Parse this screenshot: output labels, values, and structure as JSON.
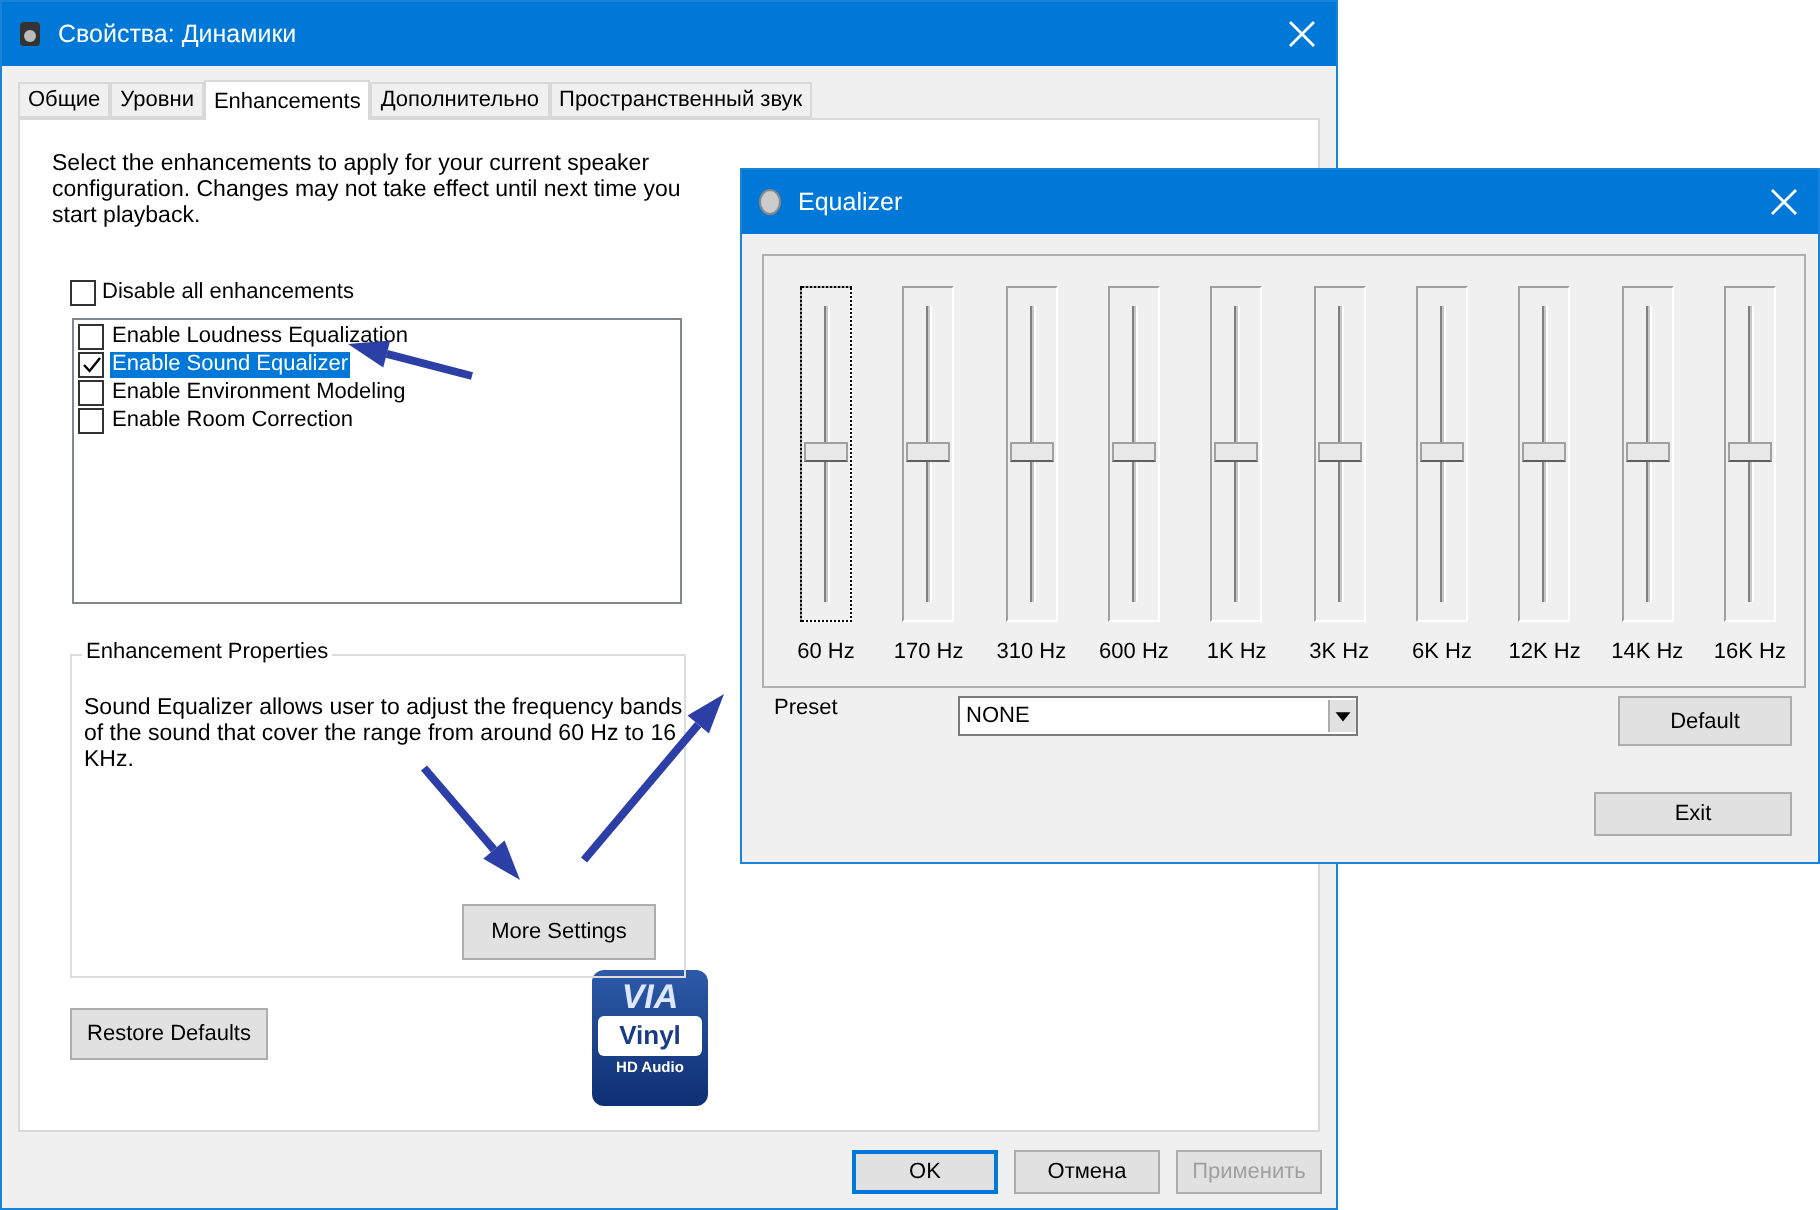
{
  "main_window": {
    "title": "Свойства: Динамики",
    "tabs": [
      {
        "label": "Общие",
        "selected": false
      },
      {
        "label": "Уровни",
        "selected": false
      },
      {
        "label": "Enhancements",
        "selected": true
      },
      {
        "label": "Дополнительно",
        "selected": false
      },
      {
        "label": "Пространственный звук",
        "selected": false
      }
    ],
    "intro": "Select the enhancements to apply for your current speaker configuration. Changes may not take effect until next time you start playback.",
    "disable_all": {
      "label": "Disable all enhancements",
      "checked": false
    },
    "enhancements": [
      {
        "label": "Enable Loudness Equalization",
        "checked": false,
        "selected": false
      },
      {
        "label": "Enable Sound Equalizer",
        "checked": true,
        "selected": true
      },
      {
        "label": "Enable Environment Modeling",
        "checked": false,
        "selected": false
      },
      {
        "label": "Enable Room Correction",
        "checked": false,
        "selected": false
      }
    ],
    "properties": {
      "title": "Enhancement Properties",
      "description": "Sound Equalizer allows user to adjust the frequency bands of the sound that cover the range from around 60 Hz to 16 KHz.",
      "button": "More Settings"
    },
    "restore_button": "Restore Defaults",
    "logo": {
      "brand": "VIA",
      "name": "Vinyl",
      "tagline": "HD Audio"
    },
    "buttons": [
      {
        "label": "OK",
        "disabled": false,
        "default": true
      },
      {
        "label": "Отмена",
        "disabled": false,
        "default": false
      },
      {
        "label": "Применить",
        "disabled": true,
        "default": false
      }
    ]
  },
  "equalizer": {
    "title": "Equalizer",
    "bands": [
      {
        "label": "60 Hz",
        "level": 0.5,
        "focused": true
      },
      {
        "label": "170 Hz",
        "level": 0.5,
        "focused": false
      },
      {
        "label": "310 Hz",
        "level": 0.5,
        "focused": false
      },
      {
        "label": "600 Hz",
        "level": 0.5,
        "focused": false
      },
      {
        "label": "1K Hz",
        "level": 0.5,
        "focused": false
      },
      {
        "label": "3K Hz",
        "level": 0.5,
        "focused": false
      },
      {
        "label": "6K Hz",
        "level": 0.5,
        "focused": false
      },
      {
        "label": "12K Hz",
        "level": 0.5,
        "focused": false
      },
      {
        "label": "14K Hz",
        "level": 0.5,
        "focused": false
      },
      {
        "label": "16K Hz",
        "level": 0.5,
        "focused": false
      }
    ],
    "preset": {
      "label": "Preset",
      "value": "NONE"
    },
    "buttons": [
      "Default",
      "Exit"
    ]
  }
}
